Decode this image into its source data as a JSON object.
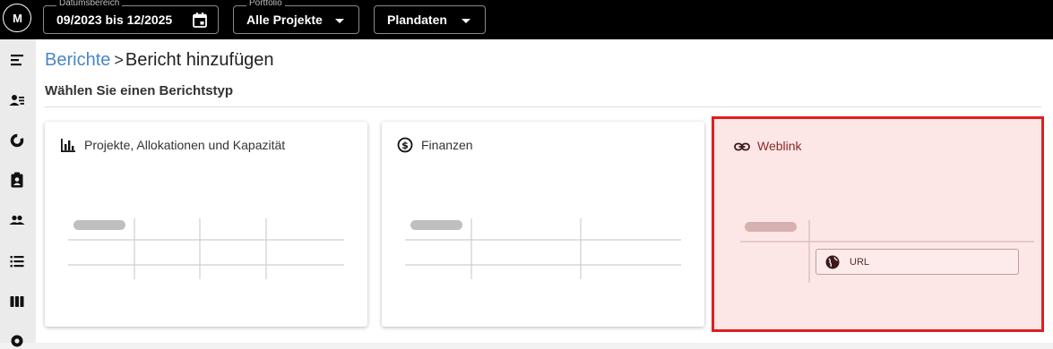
{
  "topbar": {
    "logo_text": "M",
    "date_range": {
      "label": "Datumsbereich",
      "value": "09/2023 bis 12/2025"
    },
    "portfolio": {
      "label": "Portfolio",
      "value": "Alle Projekte"
    },
    "data_type": {
      "value": "Plandaten"
    }
  },
  "sidebar": {
    "items": [
      {
        "icon": "menu-collapse-icon"
      },
      {
        "icon": "person-list-icon"
      },
      {
        "icon": "donut-chart-icon"
      },
      {
        "icon": "clipboard-person-icon"
      },
      {
        "icon": "group-icon"
      },
      {
        "icon": "list-icon"
      },
      {
        "icon": "columns-icon"
      },
      {
        "icon": "settings-icon"
      }
    ]
  },
  "breadcrumb": {
    "parent": "Berichte",
    "separator": ">",
    "current": "Bericht hinzufügen"
  },
  "subtitle": "Wählen Sie einen Berichtstyp",
  "cards": {
    "projects": {
      "title": "Projekte, Allokationen und Kapazität",
      "icon": "bar-chart-icon"
    },
    "finance": {
      "title": "Finanzen",
      "icon": "dollar-circle-icon"
    },
    "weblink": {
      "title": "Weblink",
      "icon": "link-icon",
      "url_label": "URL",
      "url_icon": "globe-icon",
      "highlight_color": "#e01e1e",
      "background_color": "#fde6e6"
    }
  }
}
